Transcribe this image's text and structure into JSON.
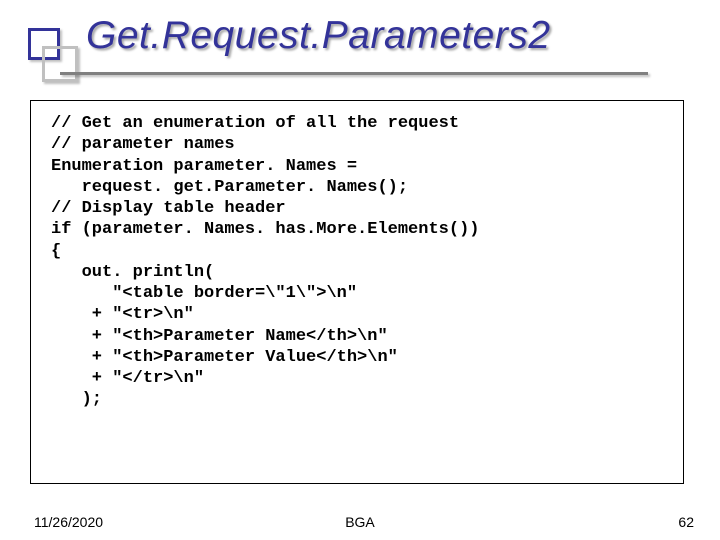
{
  "slide": {
    "title": "Get.Request.Parameters2",
    "code_lines": {
      "l1": "// Get an enumeration of all the request",
      "l2": "// parameter names",
      "l3": "",
      "l4": "Enumeration parameter. Names =",
      "l5": "   request. get.Parameter. Names();",
      "l6": "",
      "l7": "// Display table header",
      "l8": "if (parameter. Names. has.More.Elements())",
      "l9": "{",
      "l10": "   out. println(",
      "l11": "      \"<table border=\\\"1\\\">\\n\"",
      "l12": "    + \"<tr>\\n\"",
      "l13": "    + \"<th>Parameter Name</th>\\n\"",
      "l14": "    + \"<th>Parameter Value</th>\\n\"",
      "l15": "    + \"</tr>\\n\"",
      "l16": "   );"
    },
    "footer": {
      "date": "11/26/2020",
      "center": "BGA",
      "page": "62"
    }
  }
}
